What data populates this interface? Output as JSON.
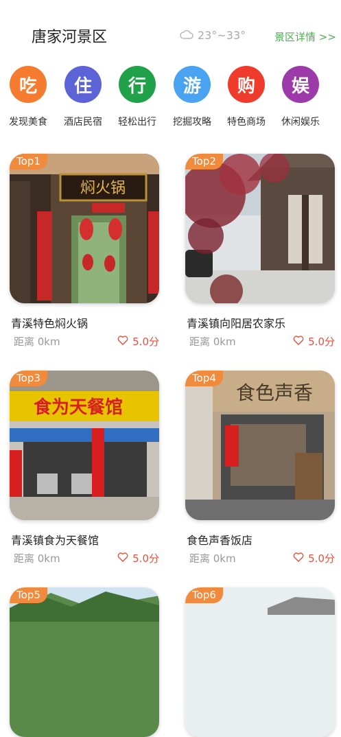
{
  "header": {
    "title": "唐家河景区",
    "weather": "23°~33°",
    "detail_link": "景区详情 >>"
  },
  "categories": [
    {
      "glyph": "吃",
      "label": "发现美食",
      "color": "#f47b2f"
    },
    {
      "glyph": "住",
      "label": "酒店民宿",
      "color": "#5b63d6"
    },
    {
      "glyph": "行",
      "label": "轻松出行",
      "color": "#21a24a"
    },
    {
      "glyph": "游",
      "label": "挖掘攻略",
      "color": "#4aa3f0"
    },
    {
      "glyph": "购",
      "label": "特色商场",
      "color": "#ef3b2c"
    },
    {
      "glyph": "娱",
      "label": "休闲娱乐",
      "color": "#9b3aa8"
    }
  ],
  "places": [
    {
      "rank": "Top1",
      "name": "青溪特色焖火锅",
      "distance": "距离 0km",
      "rating": "5.0分",
      "sign": "焖火锅"
    },
    {
      "rank": "Top2",
      "name": "青溪镇向阳居农家乐",
      "distance": "距离 0km",
      "rating": "5.0分"
    },
    {
      "rank": "Top3",
      "name": "青溪镇食为天餐馆",
      "distance": "距离 0km",
      "rating": "5.0分",
      "sign": "食为天餐馆"
    },
    {
      "rank": "Top4",
      "name": "食色声香饭店",
      "distance": "距离 0km",
      "rating": "5.0分",
      "sign": "食色声香"
    },
    {
      "rank": "Top5"
    },
    {
      "rank": "Top6"
    }
  ],
  "colors": {
    "accent": "#f08a3c",
    "rating": "#e0533d",
    "link": "#4caf50"
  }
}
